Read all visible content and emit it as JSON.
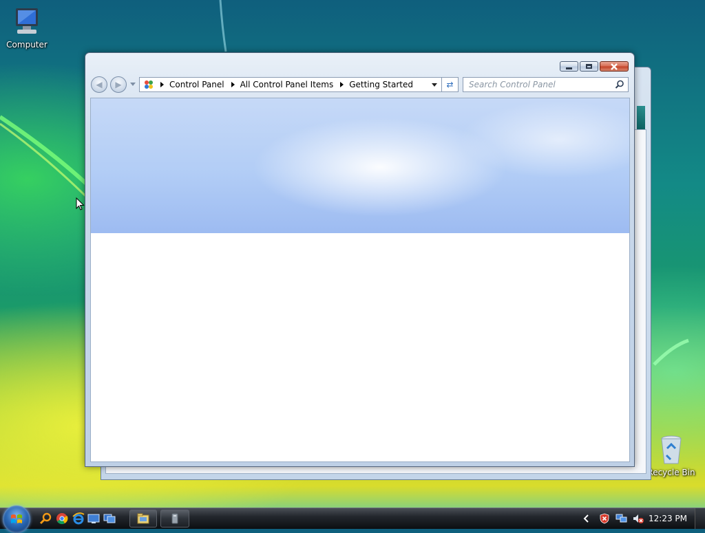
{
  "desktop": {
    "icons": [
      {
        "label": "Computer",
        "icon": "computer-icon"
      },
      {
        "label": "Recycle Bin",
        "icon": "recycle-bin-icon"
      }
    ]
  },
  "window": {
    "breadcrumb": [
      "Control Panel",
      "All Control Panel Items",
      "Getting Started"
    ],
    "search_placeholder": "Search Control Panel",
    "controls": {
      "minimize": "minimize-icon",
      "maximize": "maximize-icon",
      "close": "close-icon"
    }
  },
  "taskbar": {
    "quick_launch": [
      "search-icon",
      "chrome-icon",
      "internet-explorer-icon",
      "show-desktop-icon",
      "switch-windows-icon"
    ],
    "buttons": [
      "control-panel-task-icon",
      "app-task-icon"
    ],
    "tray": [
      "show-hidden-icons-chevron",
      "security-alert-icon",
      "network-icon",
      "volume-muted-icon"
    ],
    "clock": "12:23 PM"
  },
  "colors": {
    "close_button": "#c34126",
    "banner": "#b2cdf6",
    "taskbar": "#23272d"
  }
}
